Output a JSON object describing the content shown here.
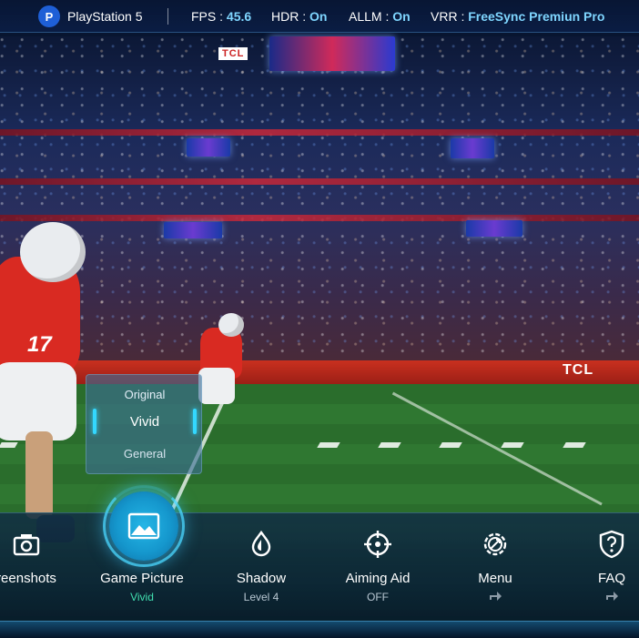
{
  "status_bar": {
    "console": "PlayStation 5",
    "fps_label": "FPS :",
    "fps_value": "45.6",
    "hdr_label": "HDR :",
    "hdr_value": "On",
    "allm_label": "ALLM :",
    "allm_value": "On",
    "vrr_label": "VRR :",
    "vrr_value": "FreeSync Premiun Pro"
  },
  "picture_selector": {
    "options": [
      "Original",
      "Vivid",
      "General"
    ],
    "selected": "Vivid"
  },
  "dock": {
    "items": [
      {
        "label": "Screenshots",
        "visible_label": "reenshots",
        "sub": "",
        "icon": "camera-icon"
      },
      {
        "label": "Game Picture",
        "sub": "Vivid",
        "icon": "picture-icon",
        "active": true
      },
      {
        "label": "Shadow",
        "sub": "Level 4",
        "icon": "shadow-drop-icon"
      },
      {
        "label": "Aiming Aid",
        "sub": "OFF",
        "icon": "crosshair-icon"
      },
      {
        "label": "Menu",
        "sub": "",
        "icon": "menu-gear-icon",
        "has_arrow": true
      },
      {
        "label": "FAQ",
        "sub": "",
        "icon": "faq-shield-icon",
        "has_arrow": true
      }
    ]
  },
  "stadium_signage": {
    "wall_logo": "TCL",
    "top_sign": "TCL"
  },
  "player_number": "17",
  "colors": {
    "accent": "#33d8ff",
    "active_sub": "#41e0b0",
    "status_value": "#7fd6ff"
  }
}
